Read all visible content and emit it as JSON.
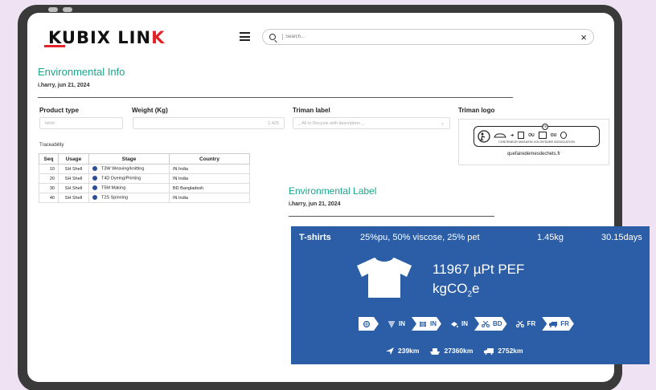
{
  "header": {
    "logo": {
      "part1": "KUBIX",
      "part2": "LIN",
      "part3": "K"
    },
    "search_placeholder": "Search...",
    "clear_symbol": "×"
  },
  "environmental_info": {
    "title": "Environmental Info",
    "meta": "i.harry, jun 21, 2024"
  },
  "form": {
    "product_type_label": "Product type",
    "product_type_value": "tshirt",
    "weight_label": "Weight (Kg)",
    "weight_value": "1.425",
    "triman_label_label": "Triman label",
    "triman_label_value": "_ All to Recycle with description _",
    "triman_logo_label": "Triman logo"
  },
  "triman": {
    "fr_badge": "FR",
    "or_text": "OU",
    "caption": "CONTENEUR  MAGASIN  VOLONTAIRE  ASSOCIATION",
    "url": "quefairedemesdechets.fr"
  },
  "traceability": {
    "label": "Traceability",
    "columns": [
      "Seq",
      "Usage",
      "Stage",
      "Country"
    ],
    "rows": [
      {
        "seq": "10",
        "usage": "SH Shell",
        "stage": "T3W Weaving/knitting",
        "country": "IN India"
      },
      {
        "seq": "20",
        "usage": "SH Shell",
        "stage": "T4D Dyeing/Printing",
        "country": "IN India"
      },
      {
        "seq": "30",
        "usage": "SH Shell",
        "stage": "T5M Making",
        "country": "BD Bangladesh"
      },
      {
        "seq": "40",
        "usage": "SH Shell",
        "stage": "T2S Spinning",
        "country": "IN India"
      }
    ]
  },
  "environmental_label": {
    "title": "Environmental Label",
    "meta": "i.harry, jun 21, 2024",
    "card": {
      "product": "T-shirts",
      "composition": "25%pu, 50% viscose, 25% pet",
      "weight": "1.45kg",
      "duration": "30.15days",
      "score": "11967 µPt PEF",
      "co2_prefix": "kgCO",
      "co2_sub": "2",
      "co2_suffix": "e",
      "steps": [
        {
          "icon": "yarn-icon",
          "country": "",
          "style": "white"
        },
        {
          "icon": "spinning-icon",
          "country": "IN",
          "style": "blue"
        },
        {
          "icon": "fabric-icon",
          "country": "IN",
          "style": "white"
        },
        {
          "icon": "dye-icon",
          "country": "IN",
          "style": "blue"
        },
        {
          "icon": "scissors-icon",
          "country": "BD",
          "style": "white"
        },
        {
          "icon": "scissors-icon",
          "country": "FR",
          "style": "blue"
        },
        {
          "icon": "truck-icon",
          "country": "FR",
          "style": "white"
        }
      ],
      "distances": {
        "air": "239km",
        "sea": "27360km",
        "road": "2752km"
      }
    }
  },
  "colors": {
    "accent_green": "#19a58c",
    "brand_red": "#e2232a",
    "card_blue": "#2b5ea6",
    "dot_blue": "#2b4f97"
  }
}
